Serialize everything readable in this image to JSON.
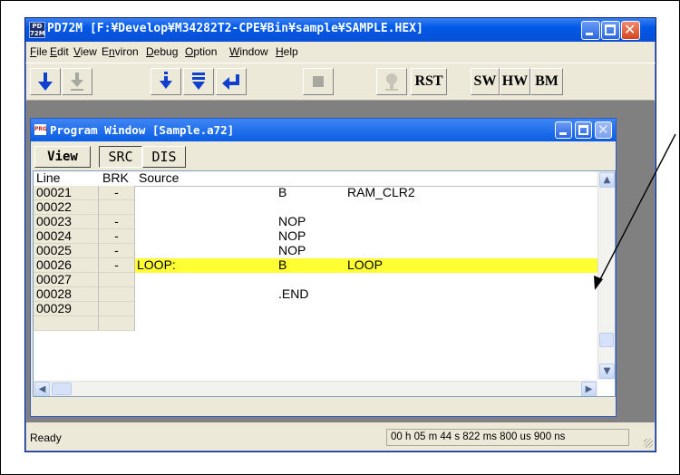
{
  "main_window": {
    "title": "PD72M  [F:¥Develop¥M34282T2-CPE¥Bin¥sample¥SAMPLE.HEX]",
    "app_icon_text": "PD 72M",
    "menu": [
      {
        "label": "File"
      },
      {
        "label": "Edit"
      },
      {
        "label": "View"
      },
      {
        "label": "Environ"
      },
      {
        "label": "Debug"
      },
      {
        "label": "Option"
      },
      {
        "label": "Window"
      },
      {
        "label": "Help"
      }
    ],
    "toolbar": {
      "rst_label": "RST",
      "sw_label": "SW",
      "hw_label": "HW",
      "bm_label": "BM"
    },
    "status": {
      "ready": "Ready",
      "time": "00 h 05 m 44 s 822 ms 800 us 900 ns"
    }
  },
  "program_window": {
    "title": "Program Window [Sample.a72]",
    "icon_text": "PRG",
    "view_button": "View",
    "tabs": [
      {
        "label": "SRC",
        "selected": true
      },
      {
        "label": "DIS",
        "selected": false
      }
    ],
    "columns": [
      "Line",
      "BRK",
      "Source"
    ],
    "rows": [
      {
        "line": "00021",
        "brk": "-",
        "label": "",
        "op": "B",
        "arg": "RAM_CLR2",
        "highlight": false
      },
      {
        "line": "00022",
        "brk": "",
        "label": "",
        "op": "",
        "arg": "",
        "highlight": false
      },
      {
        "line": "00023",
        "brk": "-",
        "label": "",
        "op": "NOP",
        "arg": "",
        "highlight": false
      },
      {
        "line": "00024",
        "brk": "-",
        "label": "",
        "op": "NOP",
        "arg": "",
        "highlight": false
      },
      {
        "line": "00025",
        "brk": "-",
        "label": "",
        "op": "NOP",
        "arg": "",
        "highlight": false
      },
      {
        "line": "00026",
        "brk": "-",
        "label": "LOOP:",
        "op": "B",
        "arg": "LOOP",
        "highlight": true
      },
      {
        "line": "00027",
        "brk": "",
        "label": "",
        "op": "",
        "arg": "",
        "highlight": false
      },
      {
        "line": "00028",
        "brk": "",
        "label": "",
        "op": ".END",
        "arg": "",
        "highlight": false
      },
      {
        "line": "00029",
        "brk": "",
        "label": "",
        "op": "",
        "arg": "",
        "highlight": false
      },
      {
        "line": "",
        "brk": "",
        "label": "",
        "op": "",
        "arg": "",
        "highlight": false
      }
    ],
    "highlight_color": "#ffff33"
  }
}
